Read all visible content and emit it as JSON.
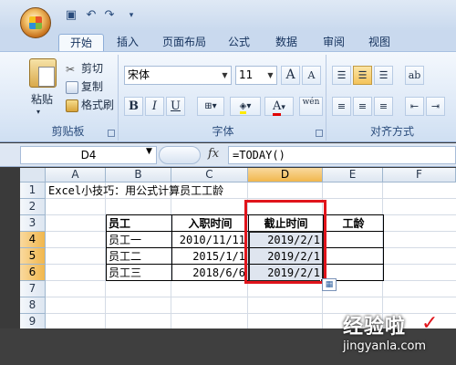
{
  "quick_access": {
    "save_icon": "save-icon",
    "undo_icon": "undo-icon",
    "redo_icon": "redo-icon",
    "customize_icon": "chevron-down-icon"
  },
  "tabs": [
    "开始",
    "插入",
    "页面布局",
    "公式",
    "数据",
    "审阅",
    "视图"
  ],
  "active_tab": "开始",
  "ribbon": {
    "clipboard": {
      "label": "剪贴板",
      "paste": "粘贴",
      "cut": "剪切",
      "copy": "复制",
      "format_painter": "格式刷"
    },
    "font": {
      "label": "字体",
      "font_name": "宋体",
      "font_size": "11",
      "bold": "B",
      "italic": "I",
      "underline": "U",
      "grow": "A",
      "shrink": "A",
      "font_color_letter": "A",
      "phonetic": "wén"
    },
    "alignment": {
      "label": "对齐方式"
    }
  },
  "formula_bar": {
    "name_box": "D4",
    "fx": "fx",
    "formula": "=TODAY()"
  },
  "columns": [
    "A",
    "B",
    "C",
    "D",
    "E",
    "F"
  ],
  "selected_column": "D",
  "rows": [
    "1",
    "2",
    "3",
    "4",
    "5",
    "6",
    "7",
    "8",
    "9"
  ],
  "selected_rows": [
    "4",
    "5",
    "6"
  ],
  "sheet": {
    "title": "Excel小技巧：用公式计算员工工龄",
    "headers": [
      "员工",
      "入职时间",
      "截止时间",
      "工龄"
    ],
    "records": [
      {
        "name": "员工一",
        "hire": "2010/11/11",
        "end": "2019/2/1",
        "age": ""
      },
      {
        "name": "员工二",
        "hire": "2015/1/1",
        "end": "2019/2/1",
        "age": ""
      },
      {
        "name": "员工三",
        "hire": "2018/6/6",
        "end": "2019/2/1",
        "age": ""
      }
    ]
  },
  "watermark": {
    "main": "经验啦",
    "url": "jingyanla.com"
  },
  "colors": {
    "highlight_box": "#e0141b",
    "selection_fill": "#dfe5ef"
  }
}
